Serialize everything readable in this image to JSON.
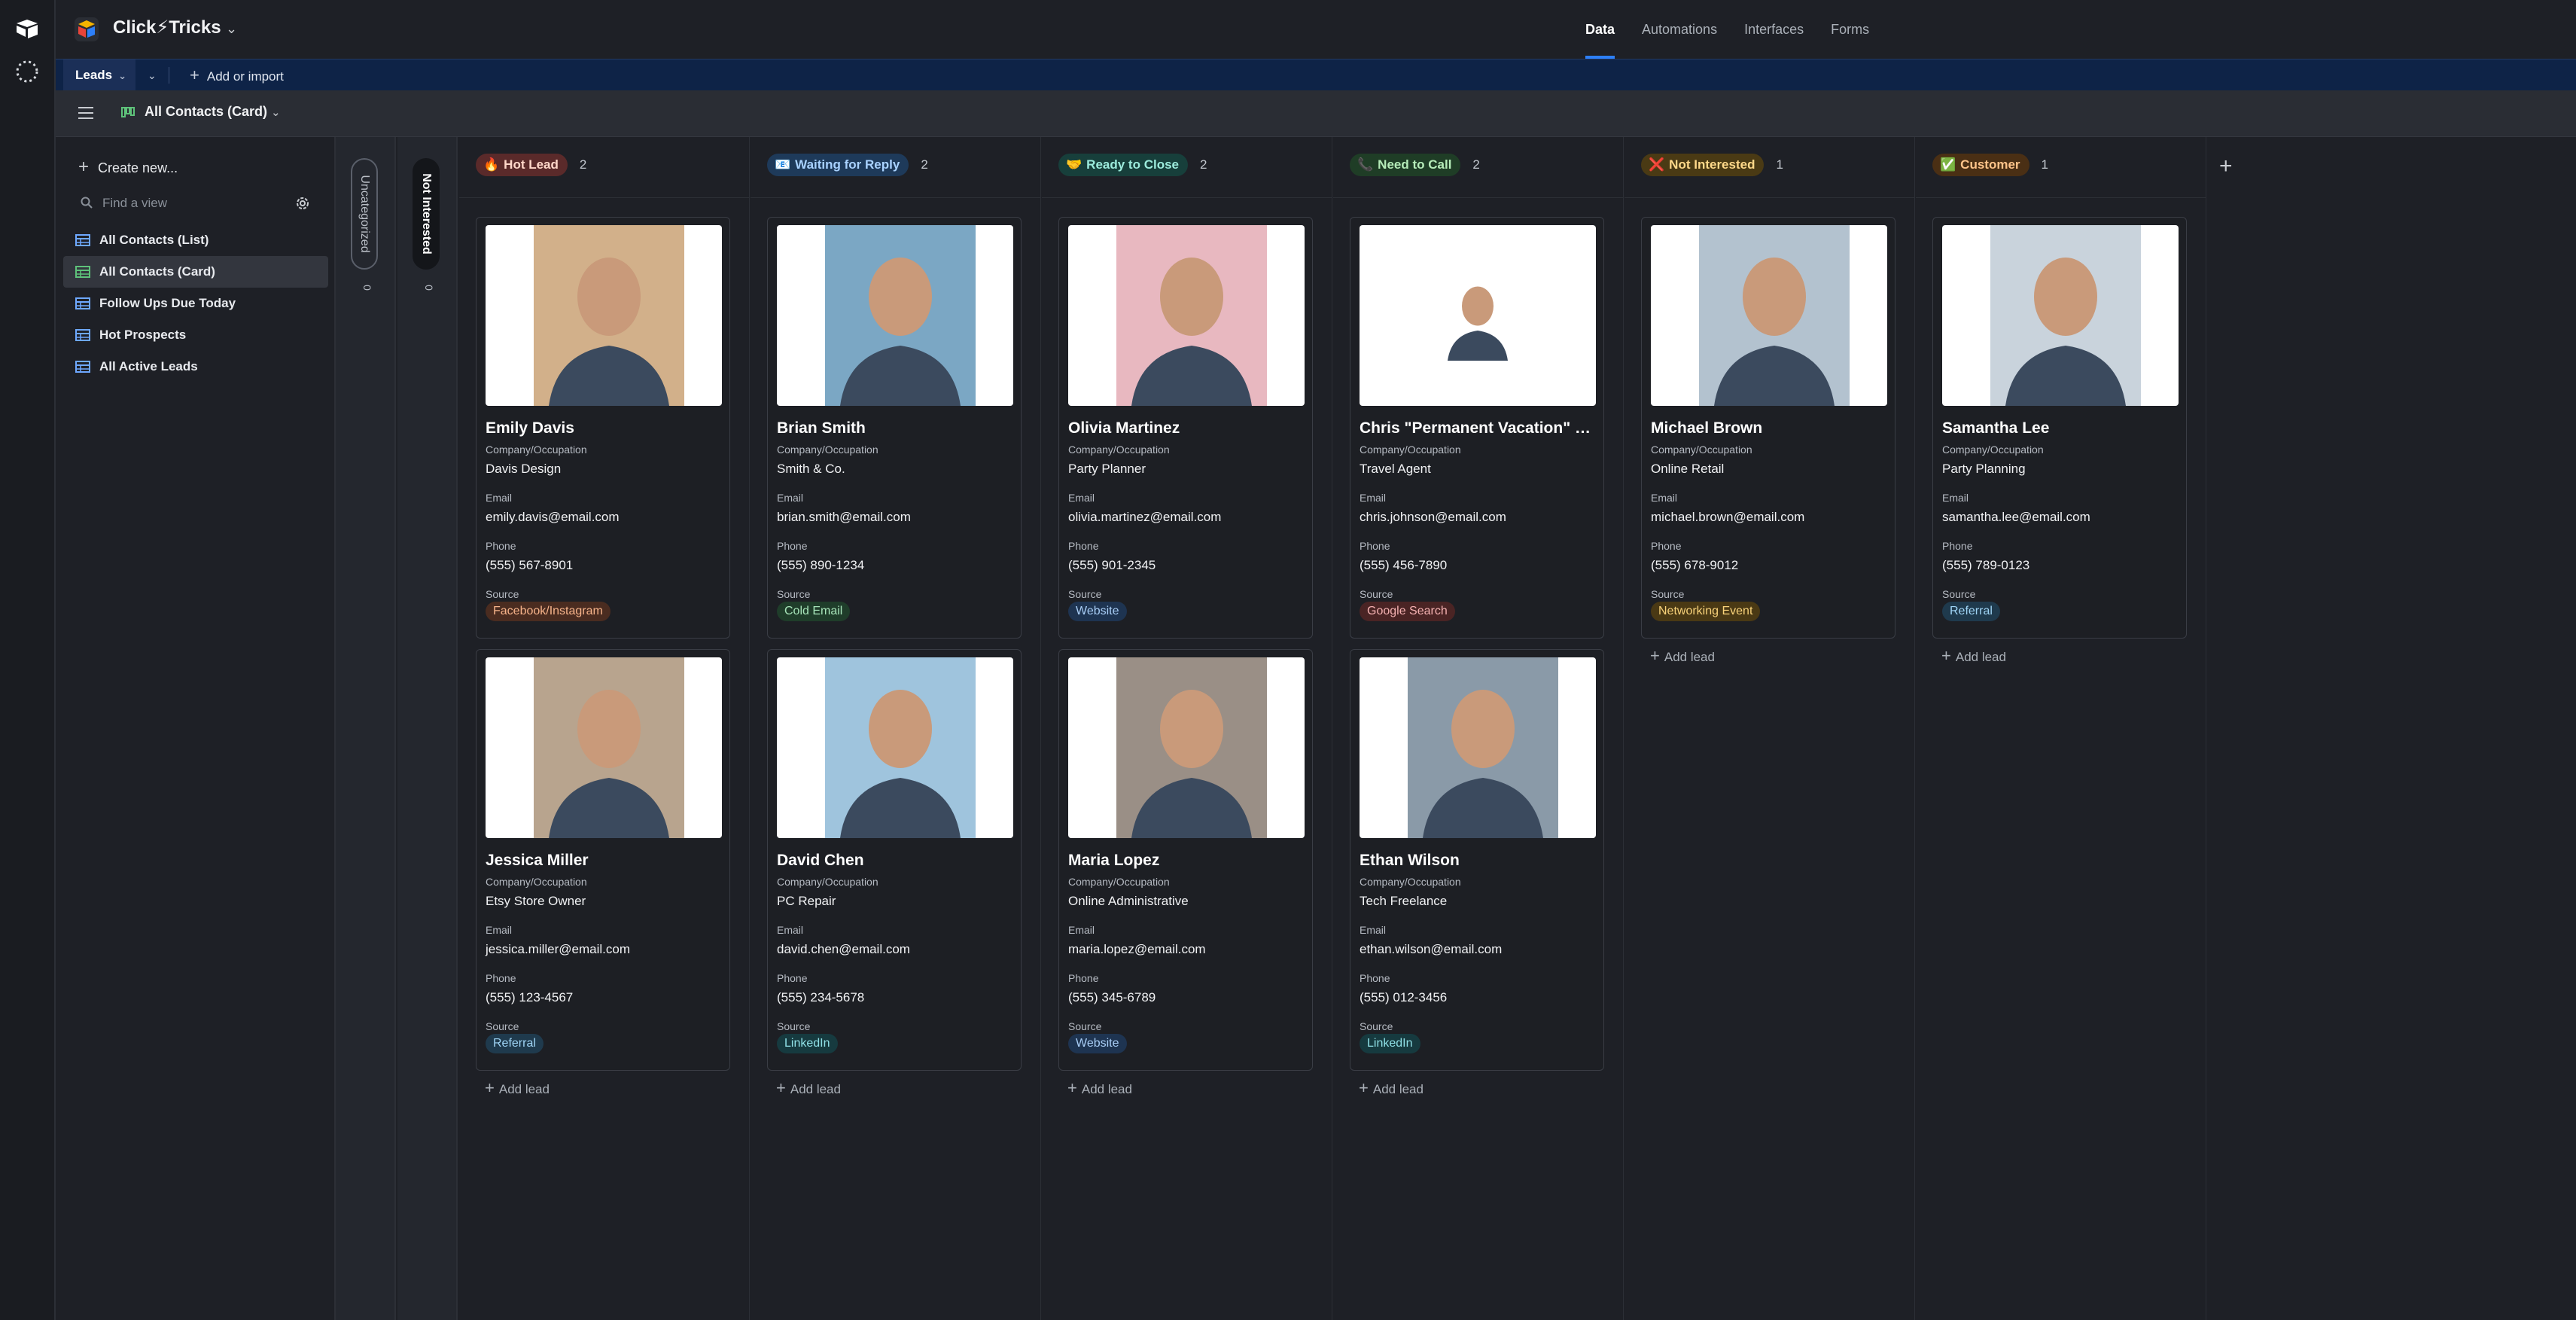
{
  "app": {
    "base_name": "Click⚡Tricks"
  },
  "top_nav": [
    {
      "label": "Data",
      "active": true
    },
    {
      "label": "Automations",
      "active": false
    },
    {
      "label": "Interfaces",
      "active": false
    },
    {
      "label": "Forms",
      "active": false
    }
  ],
  "tabbar": {
    "table_name": "Leads",
    "add_label": "Add or import"
  },
  "viewbar": {
    "current_view": "All Contacts (Card)"
  },
  "sidebar": {
    "create_new": "Create new...",
    "search_placeholder": "Find a view",
    "views": [
      {
        "label": "All Contacts (List)",
        "active": false
      },
      {
        "label": "All Contacts (Card)",
        "active": true
      },
      {
        "label": "Follow Ups Due Today",
        "active": false
      },
      {
        "label": "Hot Prospects",
        "active": false
      },
      {
        "label": "All Active Leads",
        "active": false
      }
    ]
  },
  "collapsed_columns": [
    {
      "label": "Uncategorized",
      "count": "0"
    },
    {
      "label": "Not Interested",
      "count": "0"
    }
  ],
  "field_labels": {
    "company": "Company/Occupation",
    "email": "Email",
    "phone": "Phone",
    "source": "Source"
  },
  "add_lead_label": "Add lead",
  "columns": [
    {
      "title": "Hot Lead",
      "emoji": "🔥",
      "count": "2",
      "badge_bg": "#5a2a2a",
      "badge_fg": "#ffd7c9",
      "cards": [
        {
          "name": "Emily Davis",
          "company": "Davis Design",
          "email": "emily.davis@email.com",
          "phone": "(555) 567-8901",
          "source": "Facebook/Instagram",
          "tag_bg": "#4a2c20",
          "tag_fg": "#f6b38a",
          "photo_bg": "#d2b08a"
        },
        {
          "name": "Jessica Miller",
          "company": "Etsy Store Owner",
          "email": "jessica.miller@email.com",
          "phone": "(555) 123-4567",
          "source": "Referral",
          "tag_bg": "#1f3a4d",
          "tag_fg": "#9fd4f5",
          "photo_bg": "#b8a48e"
        }
      ]
    },
    {
      "title": "Waiting for Reply",
      "emoji": "📧",
      "count": "2",
      "badge_bg": "#1e3a5a",
      "badge_fg": "#a9d2ff",
      "cards": [
        {
          "name": "Brian Smith",
          "company": "Smith & Co.",
          "email": "brian.smith@email.com",
          "phone": "(555) 890-1234",
          "source": "Cold Email",
          "tag_bg": "#1f3d2a",
          "tag_fg": "#a6e3b8",
          "photo_bg": "#7ba7c4"
        },
        {
          "name": "David Chen",
          "company": "PC Repair",
          "email": "david.chen@email.com",
          "phone": "(555) 234-5678",
          "source": "LinkedIn",
          "tag_bg": "#163a3f",
          "tag_fg": "#8fe0e6",
          "photo_bg": "#9fc4dd"
        }
      ]
    },
    {
      "title": "Ready to Close",
      "emoji": "🤝",
      "count": "2",
      "badge_bg": "#173f3b",
      "badge_fg": "#9cebdc",
      "cards": [
        {
          "name": "Olivia Martinez",
          "company": "Party Planner",
          "email": "olivia.martinez@email.com",
          "phone": "(555) 901-2345",
          "source": "Website",
          "tag_bg": "#1e3451",
          "tag_fg": "#a8cdf5",
          "photo_bg": "#e8b8c0"
        },
        {
          "name": "Maria Lopez",
          "company": "Online Administrative",
          "email": "maria.lopez@email.com",
          "phone": "(555) 345-6789",
          "source": "Website",
          "tag_bg": "#1e3451",
          "tag_fg": "#a8cdf5",
          "photo_bg": "#9a8f86"
        }
      ]
    },
    {
      "title": "Need to Call",
      "emoji": "📞",
      "count": "2",
      "badge_bg": "#1f3d26",
      "badge_fg": "#b6ecb9",
      "cards": [
        {
          "name": "Chris \"Permanent Vacation\" Johnson",
          "company": "Travel Agent",
          "email": "chris.johnson@email.com",
          "phone": "(555) 456-7890",
          "source": "Google Search",
          "tag_bg": "#4a2424",
          "tag_fg": "#f4b1b1",
          "photo_bg": "#ffffff"
        },
        {
          "name": "Ethan Wilson",
          "company": "Tech Freelance",
          "email": "ethan.wilson@email.com",
          "phone": "(555) 012-3456",
          "source": "LinkedIn",
          "tag_bg": "#163a3f",
          "tag_fg": "#8fe0e6",
          "photo_bg": "#8a9aa8"
        }
      ]
    },
    {
      "title": "Not Interested",
      "emoji": "❌",
      "count": "1",
      "badge_bg": "#4a3a14",
      "badge_fg": "#ffd98a",
      "cards": [
        {
          "name": "Michael Brown",
          "company": "Online Retail",
          "email": "michael.brown@email.com",
          "phone": "(555) 678-9012",
          "source": "Networking Event",
          "tag_bg": "#4a3914",
          "tag_fg": "#f8d27a",
          "photo_bg": "#b3c2cf"
        }
      ]
    },
    {
      "title": "Customer",
      "emoji": "✅",
      "count": "1",
      "badge_bg": "#4a2f14",
      "badge_fg": "#ffc48a",
      "cards": [
        {
          "name": "Samantha Lee",
          "company": "Party Planning",
          "email": "samantha.lee@email.com",
          "phone": "(555) 789-0123",
          "source": "Referral",
          "tag_bg": "#1f3a4d",
          "tag_fg": "#9fd4f5",
          "photo_bg": "#c9d3dc"
        }
      ]
    }
  ]
}
